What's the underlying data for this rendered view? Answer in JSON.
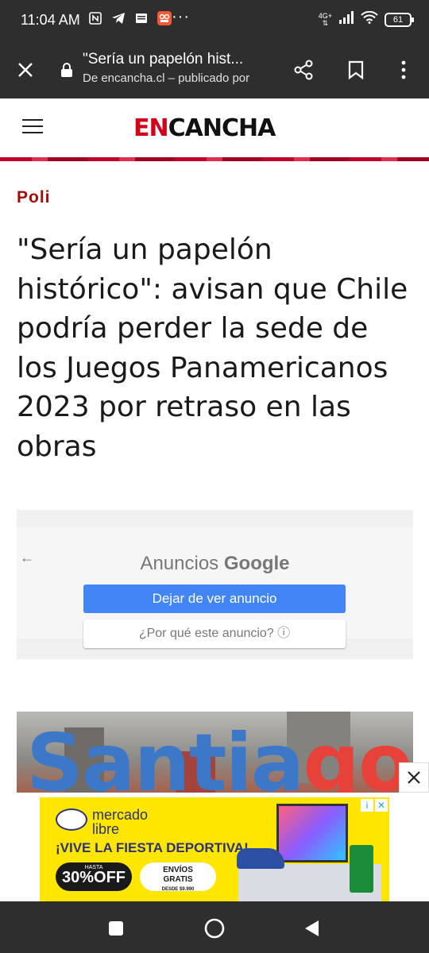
{
  "status_bar": {
    "time": "11:04 AM",
    "network": "4G+",
    "battery": "61",
    "notification_icons": [
      "nfc-icon",
      "telegram-icon",
      "news-icon",
      "app-icon"
    ],
    "overflow": "···"
  },
  "toolbar": {
    "title": "\"Sería un papelón hist...",
    "url": "De encancha.cl – publicado por"
  },
  "site": {
    "logo_en": "EN",
    "logo_cancha": "CANCHA",
    "logo_accent": "#d0021b"
  },
  "article": {
    "category": "Poli",
    "headline": "\"Sería un papelón histórico\": avisan que Chile podría perder la sede de los Juegos Panamericanos 2023 por retraso en las obras"
  },
  "ad": {
    "title_prefix": "Anuncios",
    "title_brand": "Google",
    "stop_button": "Dejar de ver anuncio",
    "why_button": "¿Por qué este anuncio? ⓘ"
  },
  "hero": {
    "text": "Santiago"
  },
  "banner": {
    "brand_line1": "mercado",
    "brand_line2": "libre",
    "promo": "¡VIVE LA FIESTA DEPORTIVA!",
    "discount_small": "HASTA",
    "discount": "30%OFF",
    "shipping_line1": "ENVÍOS",
    "shipping_line2": "GRATIS",
    "shipping_line3": "DESDE $9.990"
  }
}
